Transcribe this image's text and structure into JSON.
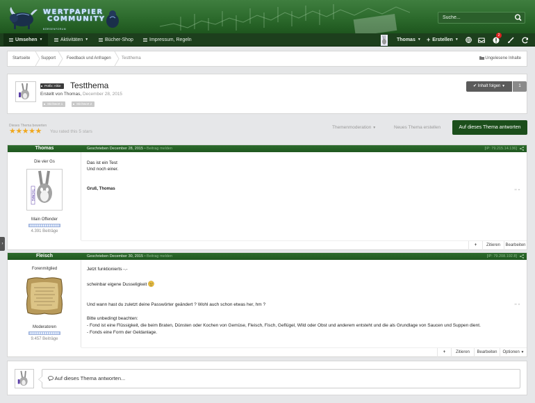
{
  "header": {
    "logo_line1": "WERTPAPIER",
    "logo_line2": "COMMUNITY",
    "logo_line3": "BÖRSENFORUM",
    "search_placeholder": "Suche..."
  },
  "nav": {
    "items": [
      {
        "label": "Umsehen",
        "active": true
      },
      {
        "label": "Aktivitäten"
      },
      {
        "label": "Bücher-Shop"
      },
      {
        "label": "Impressum, Regeln"
      }
    ],
    "user_name": "Thomas",
    "create_label": "Erstellen",
    "notification_count": "2"
  },
  "breadcrumb": {
    "items": [
      "Startseite",
      "Support",
      "Feedback und Anfragen",
      "Testthema"
    ],
    "unread_label": "Ungelesene Inhalte"
  },
  "topic": {
    "prefix": "Präfix: Alkie",
    "title": "Testthema",
    "author_label": "Erstellt von Thomas,",
    "date": "December 28, 2015",
    "tags": [
      "Stichwort 1",
      "Stichwort 2"
    ],
    "follow_label": "Inhalt folgen",
    "follow_count": "1"
  },
  "rating": {
    "label": "Dieses Thema bewerten",
    "stars": "★★★★★",
    "text": "You rated this 5 stars"
  },
  "actions": {
    "moderation": "Themenmoderation",
    "new_topic": "Neues Thema erstellen",
    "reply": "Auf dieses Thema antworten"
  },
  "posts": [
    {
      "author": "Thomas",
      "date_text": "Geschrieben December 28, 2015",
      "report": "• Beitrag melden",
      "ip": "[IP: 79.215.14.136]",
      "user_title": "Die vier Gs",
      "rank": "Main Offender",
      "count": "4.391 Beiträge",
      "lines": [
        "Das ist ein Test",
        "Und noch einer."
      ],
      "signature": "Gruß, Thomas",
      "buttons": [
        "+",
        "Zitieren",
        "Bearbeiten"
      ]
    },
    {
      "author": "Fleisch",
      "date_text": "Geschrieben December 30, 2015",
      "report": "• Beitrag melden",
      "ip": "[IP: 79.208.192.8]",
      "user_title": "Forenmitglied",
      "rank": "Moderatoren",
      "count": "9.457 Beiträge",
      "lines": [
        "Jetzt funktionierts -.-",
        "scheinbar eigene Dusseligkeit",
        "Und wann hast du zuletzt deine Passwörter geändert ? Wohl auch schon etwas her, hm ?",
        "Bitte unbedingt beachten:",
        "- Fond ist eine Flüssigkeit, die beim Braten, Dünsten oder Kochen von Gemüse, Fleisch, Fisch, Geflügel, Wild oder Obst und anderem entsteht und die als Grundlage von Saucen und Suppen dient.",
        "- Fonds eine Form der Geldanlage."
      ],
      "buttons": [
        "+",
        "Zitieren",
        "Bearbeiten",
        "Optionen"
      ]
    }
  ],
  "reply_box": {
    "placeholder": "Auf dieses Thema antworten..."
  },
  "colors": {
    "header_green": "#2c6a2c",
    "nav_dark": "#1d3f1d",
    "reply_button": "#1b4e1b",
    "star": "#f0a81e"
  }
}
